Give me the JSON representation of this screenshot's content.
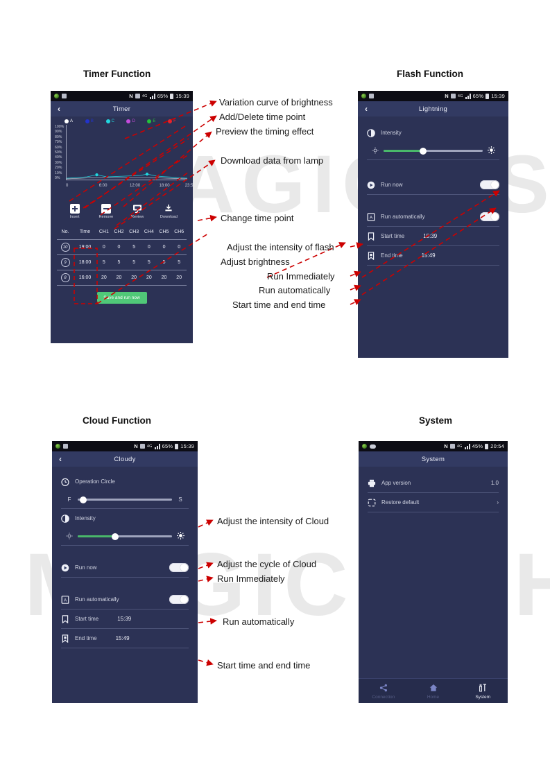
{
  "watermark": {
    "top": "MAGICFISH",
    "bottom": "MAGICFISH"
  },
  "sections": {
    "timer": {
      "caption": "Timer Function"
    },
    "flash": {
      "caption": "Flash Function"
    },
    "cloud": {
      "caption": "Cloud Function"
    },
    "system": {
      "caption": "System"
    }
  },
  "timer_screen": {
    "status": {
      "network": "N",
      "signal_label": "4G",
      "battery": "65%",
      "clock": "15:39"
    },
    "title": "Timer",
    "back": "‹",
    "legend": [
      {
        "label": "A",
        "color": "#ffffff"
      },
      {
        "label": "B",
        "color": "#2233cc"
      },
      {
        "label": "C",
        "color": "#21d7e0"
      },
      {
        "label": "D",
        "color": "#c64bdd"
      },
      {
        "label": "E",
        "color": "#23c23b"
      },
      {
        "label": "F",
        "color": "#e8232a"
      }
    ],
    "y_labels": [
      "100%",
      "90%",
      "80%",
      "70%",
      "60%",
      "50%",
      "40%",
      "30%",
      "20%",
      "10%",
      "0%"
    ],
    "x_labels": [
      "0",
      "6:00",
      "12:00",
      "18:00",
      "23:59"
    ],
    "buttons": [
      {
        "label": "Insert",
        "icon": "plus-square-icon"
      },
      {
        "label": "Remove",
        "icon": "minus-square-icon"
      },
      {
        "label": "Review",
        "icon": "monitor-icon"
      },
      {
        "label": "Download",
        "icon": "download-icon"
      }
    ],
    "table": {
      "headers": [
        "No.",
        "Time",
        "CH1",
        "CH2",
        "CH3",
        "CH4",
        "CH5",
        "CH6"
      ],
      "rows": [
        {
          "no": "10",
          "time": "19:00",
          "ch": [
            "0",
            "0",
            "5",
            "0",
            "0",
            "0"
          ]
        },
        {
          "no": "9",
          "time": "18:00",
          "ch": [
            "5",
            "5",
            "5",
            "5",
            "5",
            "5"
          ]
        },
        {
          "no": "8",
          "time": "16:00",
          "ch": [
            "20",
            "20",
            "20",
            "20",
            "20",
            "20"
          ]
        }
      ]
    },
    "save_label": "Save and run now",
    "save_color": "#50c878"
  },
  "flash_screen": {
    "status": {
      "network": "N",
      "signal_label": "4G",
      "battery": "65%",
      "clock": "15:39"
    },
    "title": "Lightning",
    "back": "‹",
    "intensity_label": "Intensity",
    "intensity_percent": 40,
    "rows": [
      {
        "label": "Run now",
        "icon": "play-circle-icon",
        "type": "toggle"
      },
      {
        "label": "Run automatically",
        "icon": "auto-doc-icon",
        "type": "toggle"
      },
      {
        "label": "Start time",
        "icon": "bookmark-icon",
        "value": "15:39",
        "type": "value"
      },
      {
        "label": "End time",
        "icon": "bookmark-filled-icon",
        "value": "15:49",
        "type": "value"
      }
    ]
  },
  "cloud_screen": {
    "status": {
      "network": "N",
      "signal_label": "4G",
      "battery": "65%",
      "clock": "15:39"
    },
    "title": "Cloudy",
    "back": "‹",
    "circle_label": "Operation Circle",
    "circle_left": "F",
    "circle_right": "S",
    "circle_percent": 6,
    "intensity_label": "Intensity",
    "intensity_percent": 40,
    "rows": [
      {
        "label": "Run now",
        "icon": "play-circle-icon",
        "type": "toggle"
      },
      {
        "label": "Run automatically",
        "icon": "auto-doc-icon",
        "type": "toggle"
      },
      {
        "label": "Start time",
        "icon": "bookmark-icon",
        "value": "15:39",
        "type": "value"
      },
      {
        "label": "End time",
        "icon": "bookmark-filled-icon",
        "value": "15:49",
        "type": "value"
      }
    ]
  },
  "system_screen": {
    "status": {
      "network": "N",
      "signal_label": "4G",
      "battery": "45%",
      "clock": "20:54"
    },
    "title": "System",
    "rows": [
      {
        "label": "App version",
        "icon": "printer-icon",
        "value": "1.0"
      },
      {
        "label": "Restore default",
        "icon": "restore-icon",
        "value": "›"
      }
    ],
    "nav": [
      {
        "label": "Connection",
        "icon": "share-icon",
        "active": false
      },
      {
        "label": "Home",
        "icon": "home-icon",
        "active": false
      },
      {
        "label": "System",
        "icon": "tools-icon",
        "active": true
      }
    ]
  },
  "annotations": {
    "a1": "Variation curve of brightness",
    "a2": "Add/Delete time point",
    "a3": "Preview the timing effect",
    "a4": "Download data from lamp",
    "a5": "Change time point",
    "a6": "Adjust the intensity of flash",
    "a7": "Adjust brightness",
    "a8": "Run Immediately",
    "a9": "Run automatically",
    "a10": "Start time and end time",
    "b1": "Adjust the intensity of Cloud",
    "b2": "Adjust the cycle of Cloud",
    "b3": "Run Immediately",
    "b4": "Run automatically",
    "b5": "Start time and end time"
  }
}
